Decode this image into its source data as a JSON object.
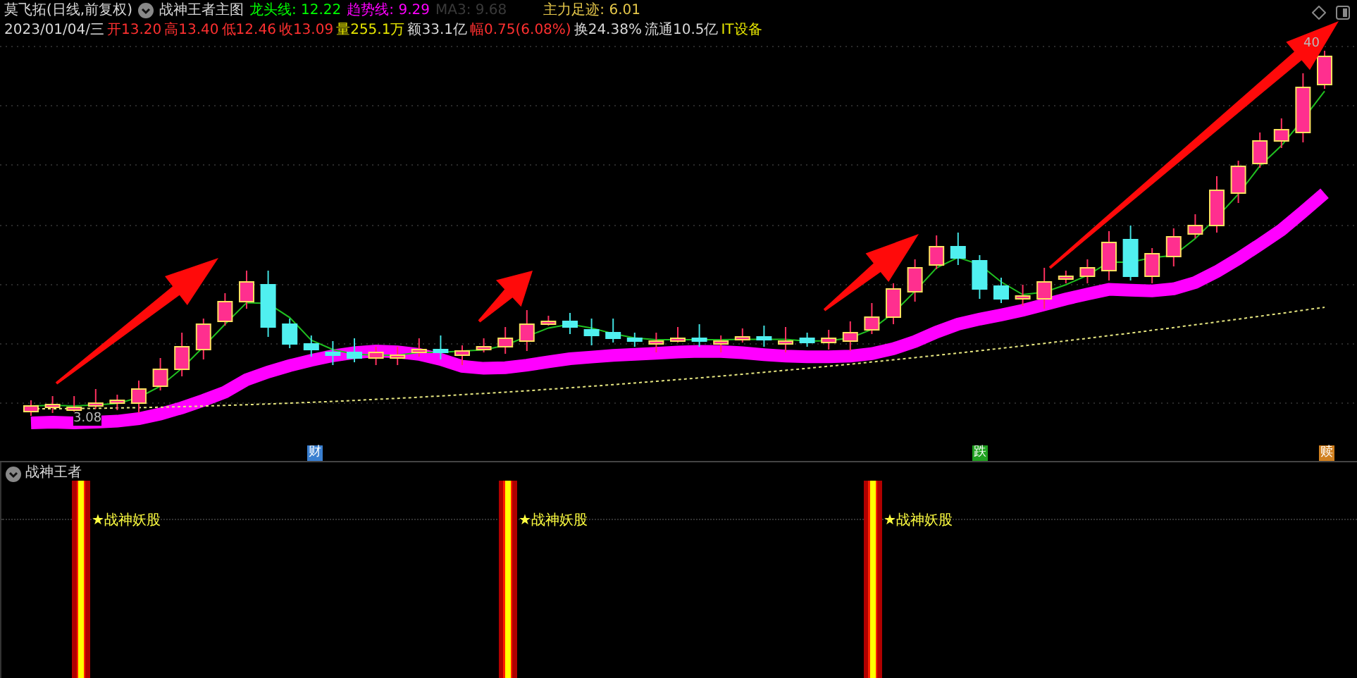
{
  "main_chart": {
    "instrument": "莫飞拓(日线,前复权)",
    "indicator_name": "战神王者主图",
    "readouts": [
      {
        "text": "龙头线: 12.22",
        "color": "#00ff00"
      },
      {
        "text": "趋势线: 9.29",
        "color": "#ff00ff"
      },
      {
        "text": "MA3: 9.68",
        "color": "#3a3a3a"
      },
      {
        "text": "主力足迹: 6.01",
        "color": "#e6c84a"
      }
    ],
    "quote": [
      {
        "text": "2023/01/04/三",
        "color": "#d8d8d8"
      },
      {
        "text": "开13.20",
        "color": "#ff3030"
      },
      {
        "text": "高13.40",
        "color": "#ff3030"
      },
      {
        "text": "低12.46",
        "color": "#ff3030"
      },
      {
        "text": "收13.09",
        "color": "#ff3030"
      },
      {
        "text": "量255.1万",
        "color": "#e6e600"
      },
      {
        "text": "额33.1亿",
        "color": "#d8d8d8"
      },
      {
        "text": "幅0.75(6.08%)",
        "color": "#ff3030"
      },
      {
        "text": "换24.38%",
        "color": "#d8d8d8"
      },
      {
        "text": "流通10.5亿",
        "color": "#d8d8d8"
      },
      {
        "text": "IT设备",
        "color": "#e6e600"
      }
    ],
    "price_labels": [
      "40",
      "3.08"
    ],
    "event_markers": [
      {
        "text": "财",
        "color": "#3a7fd0"
      },
      {
        "text": "跌",
        "color": "#20a020"
      },
      {
        "text": "赎",
        "color": "#d08020"
      }
    ]
  },
  "sub_chart": {
    "title": "战神王者",
    "signals": [
      "★战神妖股",
      "★战神妖股",
      "★战神妖股"
    ]
  }
}
